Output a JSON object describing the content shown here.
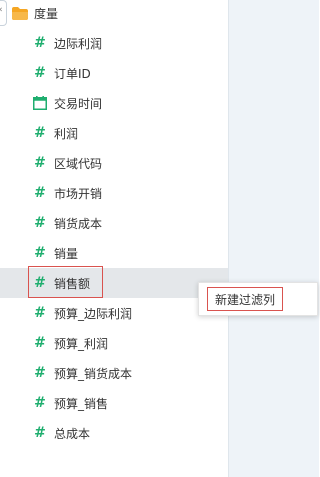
{
  "folder": {
    "label": "度量",
    "icon": "folder-icon"
  },
  "fields": [
    {
      "label": "边际利润",
      "icon": "hash-icon"
    },
    {
      "label": "订单ID",
      "icon": "hash-icon"
    },
    {
      "label": "交易时间",
      "icon": "calendar-icon"
    },
    {
      "label": "利润",
      "icon": "hash-icon"
    },
    {
      "label": "区域代码",
      "icon": "hash-icon"
    },
    {
      "label": "市场开销",
      "icon": "hash-icon"
    },
    {
      "label": "销货成本",
      "icon": "hash-icon"
    },
    {
      "label": "销量",
      "icon": "hash-icon"
    },
    {
      "label": "销售额",
      "icon": "hash-icon",
      "selected": true
    },
    {
      "label": "预算_边际利润",
      "icon": "hash-icon"
    },
    {
      "label": "预算_利润",
      "icon": "hash-icon"
    },
    {
      "label": "预算_销货成本",
      "icon": "hash-icon"
    },
    {
      "label": "预算_销售",
      "icon": "hash-icon"
    },
    {
      "label": "总成本",
      "icon": "hash-icon"
    }
  ],
  "context_menu": {
    "items": [
      {
        "label": "新建过滤列"
      }
    ]
  },
  "colors": {
    "number_icon": "#1fae6f",
    "highlight_border": "#d9534f",
    "folder": "#f5a623",
    "selected_row": "#e4e7ea"
  }
}
